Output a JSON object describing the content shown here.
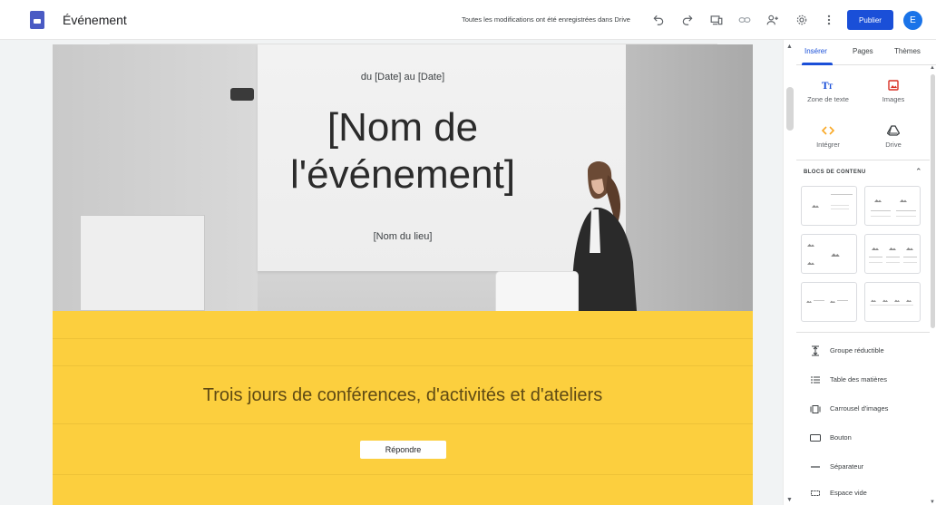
{
  "app": {
    "logo_icon": "google-sites-icon",
    "title": "Événement",
    "save_status": "Toutes les modifications ont été enregistrées dans Drive",
    "publish_label": "Publier",
    "avatar_initial": "E",
    "colors": {
      "accent": "#1a4fd8",
      "avatar": "#1a73e8",
      "banner": "#fccf3e"
    },
    "toolbar_icons": [
      "undo-icon",
      "redo-icon",
      "preview-device-icon",
      "link-icon",
      "share-person-icon",
      "settings-gear-icon",
      "more-vert-icon"
    ]
  },
  "page": {
    "hero": {
      "date": "du [Date] au [Date]",
      "name_line1": "[Nom de",
      "name_line2": "l'événement]",
      "venue": "[Nom du lieu]"
    },
    "banner": {
      "tagline": "Trois jours de conférences, d'activités et d'ateliers",
      "button_label": "Répondre"
    }
  },
  "panel": {
    "tabs": [
      {
        "label": "Insérer",
        "active": true
      },
      {
        "label": "Pages",
        "active": false
      },
      {
        "label": "Thèmes",
        "active": false
      }
    ],
    "insert_items": [
      {
        "label": "Zone de texte",
        "icon": "text-box-icon"
      },
      {
        "label": "Images",
        "icon": "image-icon"
      },
      {
        "label": "Intégrer",
        "icon": "embed-code-icon"
      },
      {
        "label": "Drive",
        "icon": "drive-icon"
      }
    ],
    "section_title": "BLOCS DE CONTENU",
    "content_blocks": 6,
    "list_items": [
      {
        "label": "Groupe réductible",
        "icon": "collapsible-group-icon"
      },
      {
        "label": "Table des matières",
        "icon": "table-of-contents-icon"
      },
      {
        "label": "Carrousel d'images",
        "icon": "image-carousel-icon"
      },
      {
        "label": "Bouton",
        "icon": "button-icon"
      },
      {
        "label": "Séparateur",
        "icon": "divider-icon"
      },
      {
        "label": "Espace vide",
        "icon": "spacer-icon"
      }
    ]
  }
}
